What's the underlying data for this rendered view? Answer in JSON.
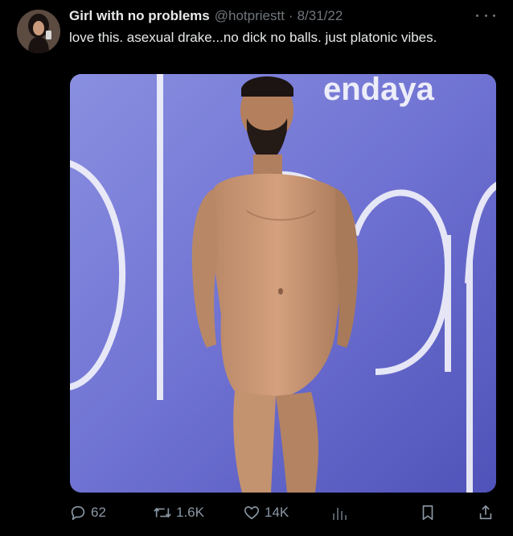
{
  "tweet": {
    "author_name": "Girl with no problems",
    "handle": "@hotpriestt",
    "separator": "·",
    "date": "8/31/22",
    "text": "love this. asexual drake...no dick no balls. just platonic vibes."
  },
  "media": {
    "backdrop_text": "endaya"
  },
  "actions": {
    "replies": "62",
    "retweets": "1.6K",
    "likes": "14K"
  },
  "icons": {
    "more": "more-dots-icon",
    "reply": "reply-icon",
    "retweet": "retweet-icon",
    "like": "heart-icon",
    "views": "analytics-icon",
    "bookmark": "bookmark-icon",
    "share": "share-icon"
  },
  "colors": {
    "background": "#000000",
    "text": "#e7e9ea",
    "muted": "#71767b",
    "backdrop": "#6b6fcf"
  }
}
